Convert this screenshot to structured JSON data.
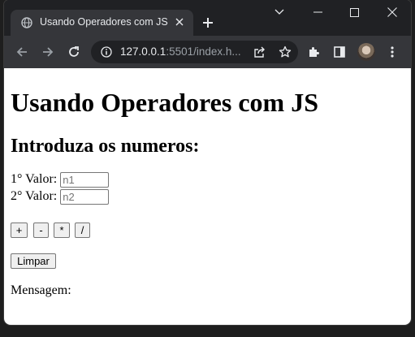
{
  "browser": {
    "tab_title": "Usando Operadores com JS",
    "url_host": "127.0.0.1",
    "url_rest": ":5501/index.h..."
  },
  "page": {
    "heading": "Usando Operadores com JS",
    "subheading": "Introduza os numeros:",
    "field1": {
      "label": "1° Valor:",
      "placeholder": "n1",
      "value": ""
    },
    "field2": {
      "label": "2° Valor:",
      "placeholder": "n2",
      "value": ""
    },
    "operators": [
      "+",
      "-",
      "*",
      "/"
    ],
    "clear_label": "Limpar",
    "message_label": "Mensagem:"
  },
  "icons": {
    "tab": "globe-icon",
    "toolbar": [
      "back-arrow-icon",
      "forward-arrow-icon",
      "reload-icon",
      "site-info-icon",
      "share-icon",
      "bookmark-star-icon",
      "extensions-puzzle-icon",
      "side-panel-icon",
      "profile-avatar",
      "menu-kebab-icon"
    ],
    "window": [
      "chevron-down-icon",
      "minimize-icon",
      "maximize-icon",
      "close-icon"
    ]
  },
  "colors": {
    "titlebar": "#202124",
    "toolbar": "#35363a",
    "page_background": "#ffffff"
  }
}
